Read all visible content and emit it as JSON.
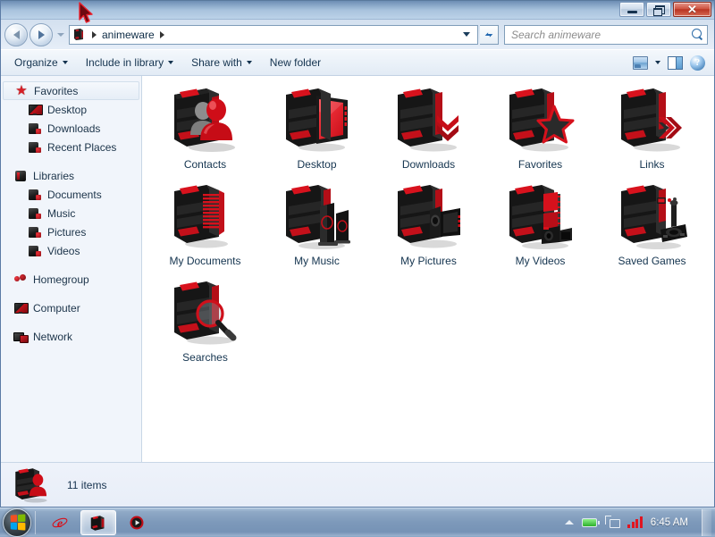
{
  "window": {
    "title": "",
    "controls": {
      "minimize_label": "Minimize",
      "restore_label": "Restore",
      "close_label": "Close"
    }
  },
  "address": {
    "back_label": "Back",
    "forward_label": "Forward",
    "history_label": "Recent pages",
    "crumbs": [
      "animeware"
    ],
    "refresh_label": "Refresh"
  },
  "search": {
    "placeholder": "Search animeware",
    "value": ""
  },
  "toolbar": {
    "items": [
      {
        "label": "Organize",
        "has_caret": true
      },
      {
        "label": "Include in library",
        "has_caret": true
      },
      {
        "label": "Share with",
        "has_caret": true
      },
      {
        "label": "New folder",
        "has_caret": false
      }
    ],
    "views_label": "Change your view",
    "preview_label": "Show the preview pane",
    "help_label": "Get help"
  },
  "sidebar": {
    "groups": [
      {
        "header": {
          "label": "Favorites",
          "icon": "star-icon",
          "selected": true
        },
        "items": [
          {
            "label": "Desktop",
            "icon": "monitor-icon"
          },
          {
            "label": "Downloads",
            "icon": "folder-download-icon"
          },
          {
            "label": "Recent Places",
            "icon": "folder-recent-icon"
          }
        ]
      },
      {
        "header": {
          "label": "Libraries",
          "icon": "library-icon",
          "selected": false
        },
        "items": [
          {
            "label": "Documents",
            "icon": "folder-documents-icon"
          },
          {
            "label": "Music",
            "icon": "folder-music-icon"
          },
          {
            "label": "Pictures",
            "icon": "folder-pictures-icon"
          },
          {
            "label": "Videos",
            "icon": "folder-videos-icon"
          }
        ]
      },
      {
        "header": {
          "label": "Homegroup",
          "icon": "homegroup-icon",
          "selected": false
        },
        "items": []
      },
      {
        "header": {
          "label": "Computer",
          "icon": "computer-icon",
          "selected": false
        },
        "items": []
      },
      {
        "header": {
          "label": "Network",
          "icon": "network-icon",
          "selected": false
        },
        "items": []
      }
    ]
  },
  "content": {
    "items": [
      {
        "label": "Contacts",
        "icon": "folder-contacts-icon"
      },
      {
        "label": "Desktop",
        "icon": "folder-desktop-icon"
      },
      {
        "label": "Downloads",
        "icon": "folder-downloads-icon"
      },
      {
        "label": "Favorites",
        "icon": "folder-favorites-icon"
      },
      {
        "label": "Links",
        "icon": "folder-links-icon"
      },
      {
        "label": "My Documents",
        "icon": "folder-documents-icon"
      },
      {
        "label": "My Music",
        "icon": "folder-music-icon"
      },
      {
        "label": "My Pictures",
        "icon": "folder-pictures-icon"
      },
      {
        "label": "My Videos",
        "icon": "folder-videos-icon"
      },
      {
        "label": "Saved Games",
        "icon": "folder-games-icon"
      },
      {
        "label": "Searches",
        "icon": "folder-searches-icon"
      }
    ]
  },
  "status": {
    "count_text": "11 items",
    "icon": "folder-contacts-icon"
  },
  "taskbar": {
    "start_label": "Start",
    "apps": [
      {
        "name": "internet-explorer",
        "active": false
      },
      {
        "name": "windows-explorer",
        "active": true
      },
      {
        "name": "media-player",
        "active": false
      }
    ],
    "tray": {
      "show_hidden_label": "Show hidden icons",
      "battery_label": "Battery",
      "network_label": "Network",
      "signal_label": "Signal strength",
      "clock": "6:45 AM",
      "show_desktop_label": "Show desktop"
    }
  },
  "theme": {
    "accent_red": "#d6111c",
    "dark": "#131313",
    "title_blue": "#a9c3de",
    "text_navy": "#14344f",
    "close_red": "#c44231"
  }
}
